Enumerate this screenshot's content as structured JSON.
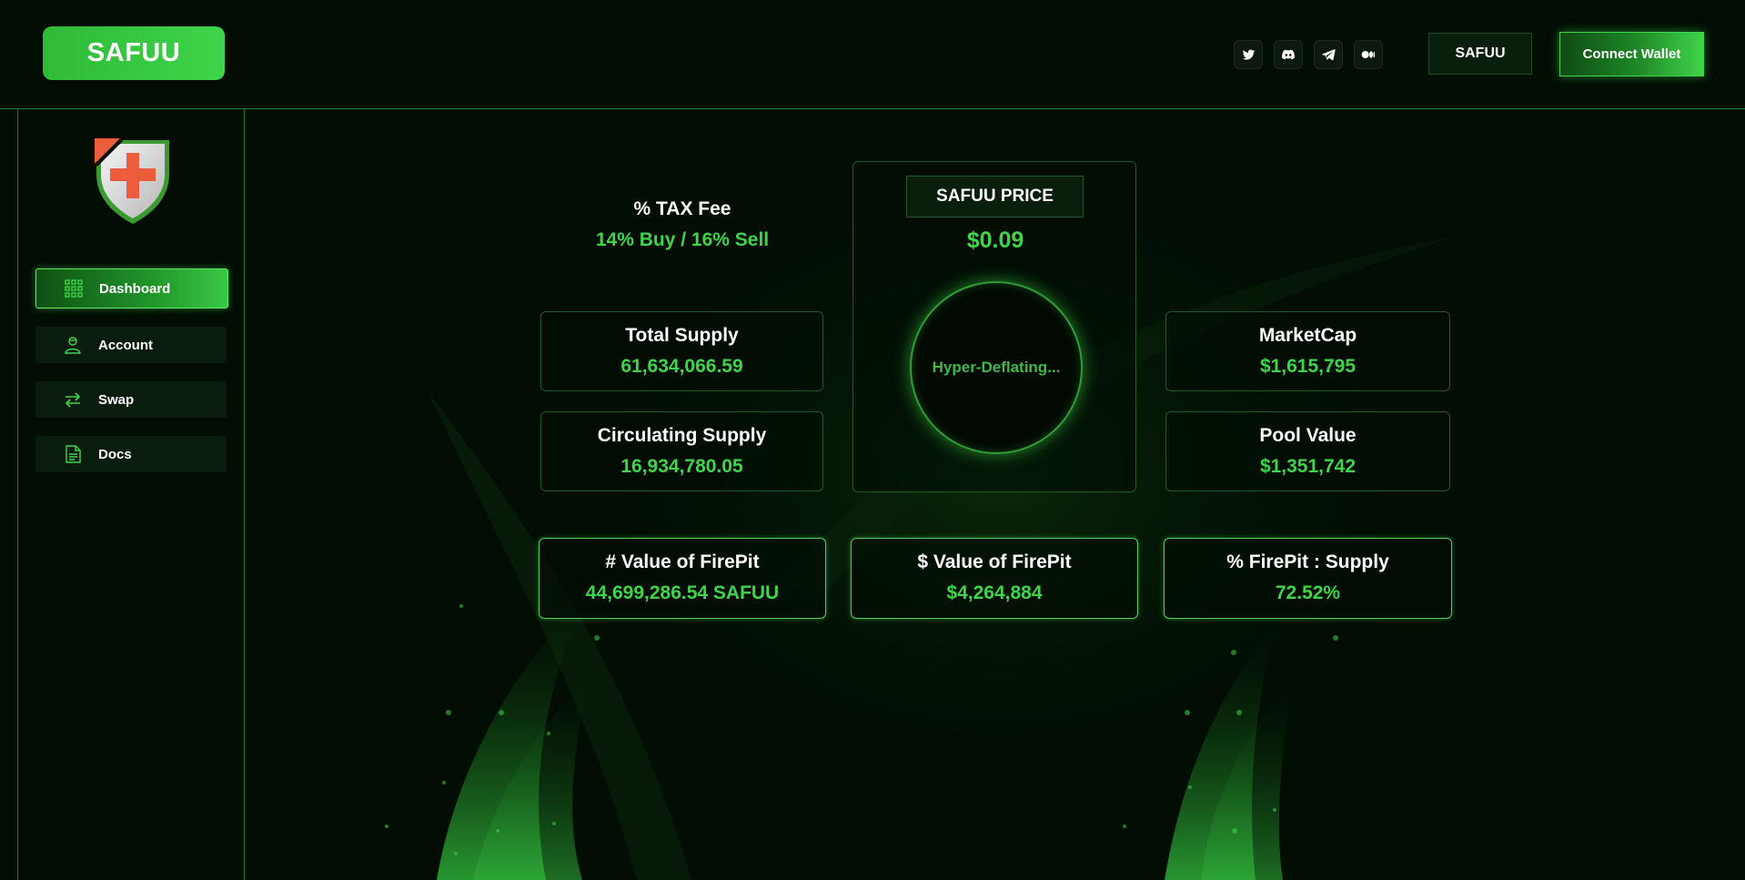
{
  "header": {
    "logo_text": "SAFUU",
    "socials": [
      {
        "icon": "twitter-icon"
      },
      {
        "icon": "discord-icon"
      },
      {
        "icon": "telegram-icon"
      },
      {
        "icon": "medium-icon"
      }
    ],
    "token_button": "SAFUU",
    "connect_button": "Connect Wallet"
  },
  "sidebar": {
    "logo_icon": "shield-cross-icon",
    "items": [
      {
        "label": "Dashboard",
        "icon": "grid-icon",
        "active": true
      },
      {
        "label": "Account",
        "icon": "user-icon",
        "active": false
      },
      {
        "label": "Swap",
        "icon": "swap-icon",
        "active": false
      },
      {
        "label": "Docs",
        "icon": "document-icon",
        "active": false
      }
    ]
  },
  "dashboard": {
    "tax": {
      "label": "% TAX Fee",
      "value": "14% Buy / 16% Sell"
    },
    "price": {
      "label": "SAFUU PRICE",
      "value": "$0.09",
      "status": "Hyper-Deflating..."
    },
    "total_supply": {
      "label": "Total Supply",
      "value": "61,634,066.59"
    },
    "circulating_supply": {
      "label": "Circulating Supply",
      "value": "16,934,780.05"
    },
    "market_cap": {
      "label": "MarketCap",
      "value": "$1,615,795"
    },
    "pool_value": {
      "label": "Pool Value",
      "value": "$1,351,742"
    },
    "firepit_amount": {
      "label": "# Value of FirePit",
      "value": "44,699,286.54 SAFUU"
    },
    "firepit_usd": {
      "label": "$ Value of FirePit",
      "value": "$4,264,884"
    },
    "firepit_ratio": {
      "label": "% FirePit : Supply",
      "value": "72.52%"
    }
  },
  "colors": {
    "background": "#020d03",
    "accent": "#3fd44a",
    "border": "#1e5a22"
  }
}
